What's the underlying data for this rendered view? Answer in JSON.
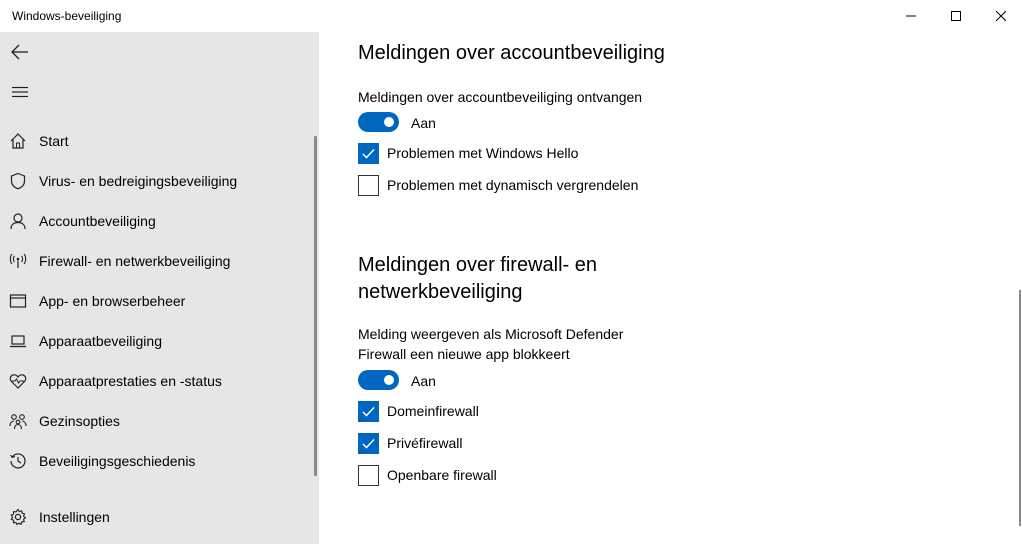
{
  "window": {
    "title": "Windows-beveiliging"
  },
  "sidebar": {
    "items": [
      {
        "label": "Start",
        "icon": "home-icon"
      },
      {
        "label": "Virus- en bedreigingsbeveiliging",
        "icon": "shield-icon"
      },
      {
        "label": "Accountbeveiliging",
        "icon": "person-icon"
      },
      {
        "label": "Firewall- en netwerkbeveiliging",
        "icon": "wireless-icon"
      },
      {
        "label": "App- en browserbeheer",
        "icon": "browser-window-icon"
      },
      {
        "label": "Apparaatbeveiliging",
        "icon": "laptop-icon"
      },
      {
        "label": "Apparaatprestaties en -status",
        "icon": "heart-pulse-icon"
      },
      {
        "label": "Gezinsopties",
        "icon": "family-icon"
      },
      {
        "label": "Beveiligingsgeschiedenis",
        "icon": "history-icon"
      }
    ],
    "settings": {
      "label": "Instellingen",
      "icon": "gear-icon"
    }
  },
  "account": {
    "title": "Meldingen over accountbeveiliging",
    "toggle_desc": "Meldingen over accountbeveiliging ontvangen",
    "toggle_state": "Aan",
    "checkboxes": [
      {
        "label": "Problemen met Windows Hello",
        "checked": true
      },
      {
        "label": "Problemen met dynamisch vergrendelen",
        "checked": false
      }
    ]
  },
  "firewall": {
    "title_line1": "Meldingen over firewall- en",
    "title_line2": "netwerkbeveiliging",
    "toggle_desc_line1": "Melding weergeven als Microsoft Defender",
    "toggle_desc_line2": "Firewall een nieuwe app blokkeert",
    "toggle_state": "Aan",
    "checkboxes": [
      {
        "label": "Domeinfirewall",
        "checked": true
      },
      {
        "label": "Privéfirewall",
        "checked": true
      },
      {
        "label": "Openbare firewall",
        "checked": false
      }
    ]
  },
  "colors": {
    "accent": "#0067c0",
    "sidebar_bg": "#e6e6e6"
  }
}
